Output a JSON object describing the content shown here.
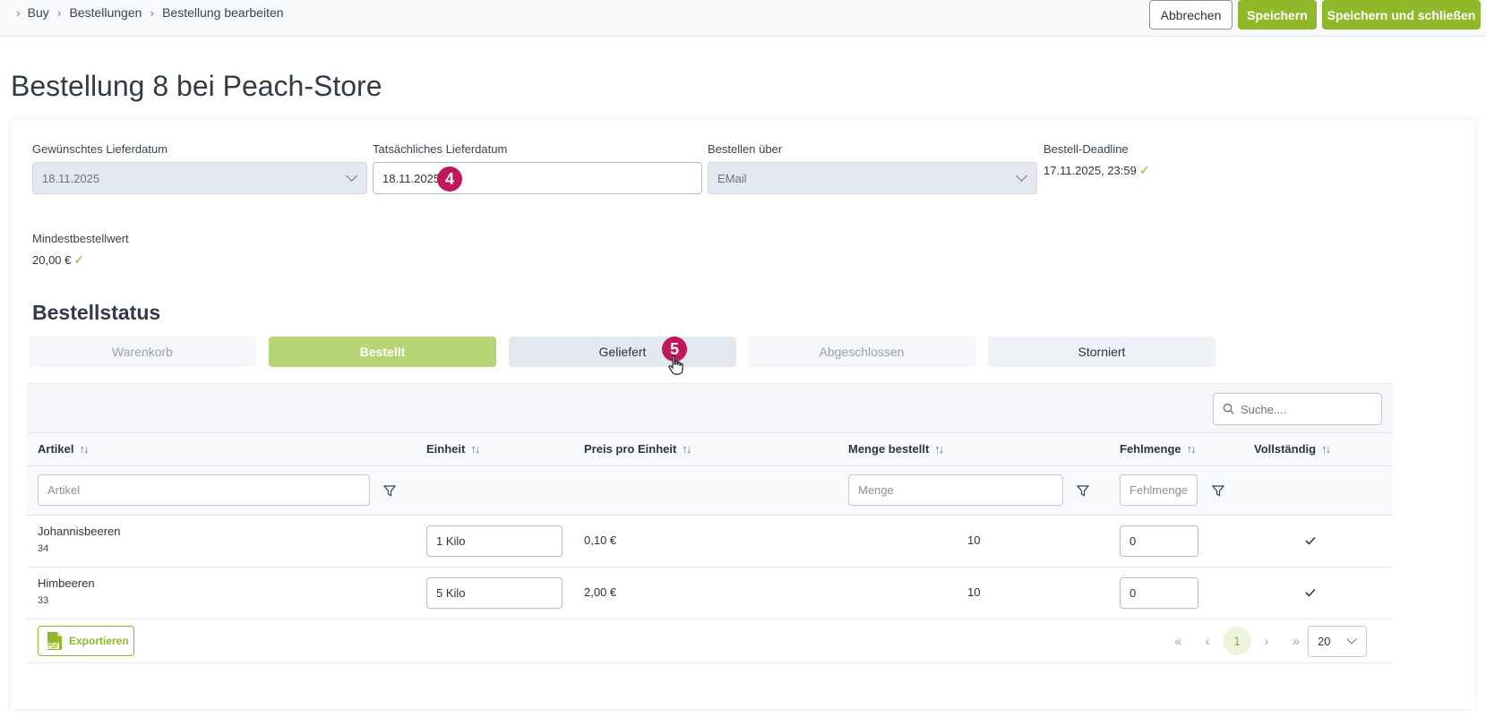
{
  "breadcrumb": {
    "items": [
      "Buy",
      "Bestellungen",
      "Bestellung bearbeiten"
    ]
  },
  "toolbar": {
    "cancel_label": "Abbrechen",
    "save_label": "Speichern",
    "save_close_label": "Speichern und schließen"
  },
  "page": {
    "title": "Bestellung 8 bei Peach-Store"
  },
  "form": {
    "desired_date": {
      "label": "Gewünschtes Lieferdatum",
      "value": "18.11.2025"
    },
    "actual_date": {
      "label": "Tatsächliches Lieferdatum",
      "value": "18.11.2025"
    },
    "order_via": {
      "label": "Bestellen über",
      "value": "EMail"
    },
    "deadline": {
      "label": "Bestell-Deadline",
      "value": "17.11.2025, 23:59"
    },
    "min_order": {
      "label": "Mindestbestellwert",
      "value": "20,00 €"
    }
  },
  "markers": {
    "step4": "4",
    "step5": "5"
  },
  "status": {
    "title": "Bestellstatus",
    "steps": [
      "Warenkorb",
      "Bestellt",
      "Geliefert",
      "Abgeschlossen",
      "Storniert"
    ],
    "active": "Bestellt"
  },
  "table": {
    "search_placeholder": "Suche....",
    "columns": [
      "Artikel",
      "Einheit",
      "Preis pro Einheit",
      "Menge bestellt",
      "Fehlmenge",
      "Vollständig"
    ],
    "filters": {
      "article": "Artikel",
      "quantity": "Menge",
      "shortage": "Fehlmenge"
    },
    "rows": [
      {
        "name": "Johannisbeeren",
        "id": "34",
        "unit": "1 Kilo",
        "price": "0,10 €",
        "ordered": "10",
        "shortage": "0"
      },
      {
        "name": "Himbeeren",
        "id": "33",
        "unit": "5 Kilo",
        "price": "2,00 €",
        "ordered": "10",
        "shortage": "0"
      }
    ],
    "export_label": "Exportieren",
    "pagination": {
      "first": "«",
      "prev": "‹",
      "current": "1",
      "next": "›",
      "last": "»",
      "page_size": "20"
    }
  },
  "colors": {
    "accent": "#8fb82a",
    "marker": "#c2185b",
    "active_status": "#b4d475"
  }
}
